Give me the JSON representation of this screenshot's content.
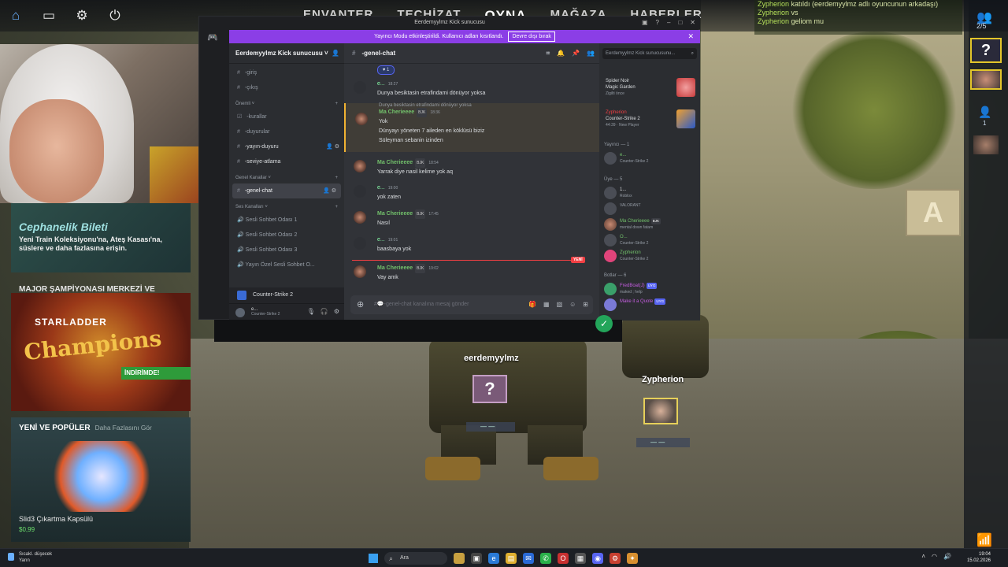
{
  "cs_menu": {
    "items": [
      "ENVANTER",
      "TEÇHİZAT",
      "OYNA",
      "MAĞAZA",
      "HABERLER"
    ],
    "active_index": 2
  },
  "cs_top_icons": [
    "home-icon",
    "tv-icon",
    "gear-icon",
    "power-icon"
  ],
  "promos": {
    "armory_title": "Cephanelik Bileti",
    "armory_text": "Yeni Train Koleksiyonu'na, Ateş Kasası'na, süslere ve daha fazlasına erişin.",
    "major_title": "MAJOR ŞAMPİYONASI MERKEZİ VE EŞYALARI",
    "major_logo": "STARLADDER",
    "major_big": "Champions",
    "major_stripe": "İNDİRİMDE!",
    "new_title": "YENİ VE POPÜLER",
    "new_more": "Daha Fazlasını Gör",
    "new_item": "Slid3 Çıkartma Kapsülü",
    "new_price": "$0,99"
  },
  "chat_log": [
    {
      "user": "Zypherion",
      "text": "katıldı (eerdemyylmz adlı oyuncunun arkadaşı)"
    },
    {
      "user": "Zypherion",
      "text": "vs"
    },
    {
      "user": "Zypherion",
      "text": "geliom mu"
    }
  ],
  "right_panel": {
    "party_count": "2/5",
    "question": "?",
    "friends_count": "1"
  },
  "lobby": {
    "player1": "eerdemyylmz",
    "player2": "Zypherion",
    "card_q": "?",
    "card_bar1": "— —",
    "card_bar2": "— —"
  },
  "discord": {
    "window_title": "Eerdemyylmz Kick sunucusu",
    "banner_text": "Yayıncı Modu etkinleştirildi. Kullanıcı adları kısıtlandı.",
    "banner_button": "Devre dışı bırak",
    "guild_name": "Eerdemyylmz Kick sunucusu",
    "channels_top": [
      {
        "name": "-giriş",
        "active": false
      },
      {
        "name": "-çıkış",
        "active": false
      }
    ],
    "cat_important": "Önemli",
    "channels_important": [
      {
        "name": "-kurallar"
      },
      {
        "name": "-duyurular"
      },
      {
        "name": "-yayın-duyuru"
      },
      {
        "name": "-seviye-atlama"
      }
    ],
    "cat_general": "Genel Kanallar",
    "active_channel": "-genel-chat",
    "cat_voice": "Ses Kanalları",
    "voice_channels": [
      "Sesli Sohbet Odası 1",
      "Sesli Sohbet Odası 2",
      "Sesli Sohbet Odası 3",
      "Yayın Özel Sesli Sohbet O..."
    ],
    "activity": "Counter-Strike 2",
    "user_name": "e...",
    "user_sub": "Counter-Strike 2",
    "channel_title": "-genel-chat",
    "reaction": "1",
    "messages": [
      {
        "name": "e...",
        "time": "18:27",
        "text": [
          "Dunya besiktasin etrafindami dönüyor yoksa"
        ],
        "mc": false
      },
      {
        "name": "Ma Cherieeee",
        "badge": "BJK",
        "time": "18:36",
        "reply": "Dunya besiktasin etrafindami dönüyor yoksa",
        "text": [
          "Yok",
          "Dünyayı yöneten 7 aileden en köklüsü biziz",
          "Süleyman sebanin izinden"
        ],
        "mc": true
      },
      {
        "name": "Ma Cherieeee",
        "badge": "BJK",
        "time": "18:54",
        "text": [
          "Yarrak diye nasil kelime yok aq"
        ],
        "mc": true
      },
      {
        "name": "e...",
        "time": "19:00",
        "text": [
          "yok zaten"
        ],
        "mc": false
      },
      {
        "name": "Ma Cherieeee",
        "badge": "BJK",
        "time": "17:45",
        "text": [
          "Nasıl"
        ],
        "mc": true
      },
      {
        "name": "e...",
        "time": "19:01",
        "text": [
          "baasbaya yok"
        ],
        "mc": false
      },
      {
        "name": "Ma Cherieeee",
        "badge": "BJK",
        "time": "19:02",
        "text": [
          "Vay amk"
        ],
        "mc": true
      }
    ],
    "new_tag": "YENİ",
    "composer_placeholder": "#💬-genel-chat kanalına mesaj gönder",
    "search_placeholder": "Eerdemyylmz Kick sunucusunu...",
    "live": [
      {
        "title": "Spider Noir",
        "game": "Magic Garden",
        "sub": "Zigilti önce"
      },
      {
        "title": "Zypherion",
        "game": "Counter-Strike 2",
        "sub": "44:39 · New Player"
      }
    ],
    "cat_streamer": "Yayıncı — 1",
    "streamer": {
      "name": "e...",
      "sub": "Counter-Strike 2"
    },
    "cat_members": "Üye — 5",
    "members": [
      {
        "name": "1...",
        "sub": "Roblox"
      },
      {
        "name": "",
        "sub": "VALORANT"
      },
      {
        "name": "Ma Cherieeee",
        "tag": "BJK",
        "sub": "mental down fatam"
      },
      {
        "name": "O...",
        "sub": "Counter-Strike 2"
      },
      {
        "name": "Zypherion",
        "sub": "Counter-Strike 2"
      }
    ],
    "cat_bots": "Botlar — 6",
    "bots": [
      {
        "name": "FredBoat(J)",
        "tag": "UYG",
        "sub": "maked ; help"
      },
      {
        "name": "Make it a Quote",
        "tag": "UYG",
        "sub": ""
      }
    ]
  },
  "taskbar": {
    "weather_line1": "Sıcakl. düşecek",
    "weather_line2": "Yarın",
    "search": "Ara",
    "time": "19:04",
    "date": "15.02.2026"
  }
}
